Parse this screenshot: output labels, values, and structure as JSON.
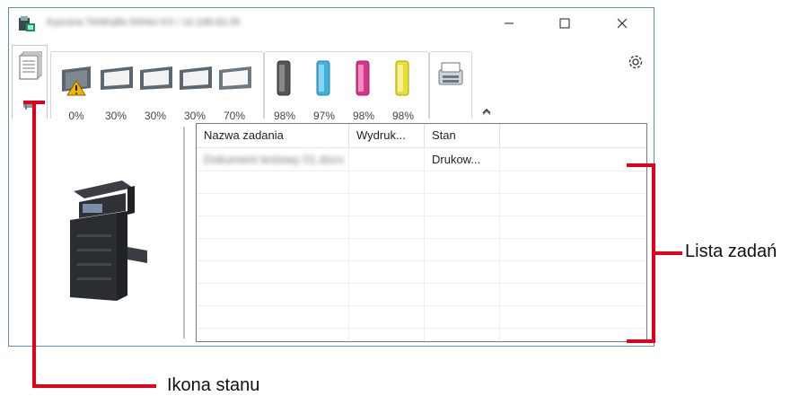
{
  "window": {
    "title": "Kyocera TASKalfa 5054ci KX / 10.168.63.35"
  },
  "titlebar_buttons": {
    "minimize_icon": "minimize-icon",
    "maximize_icon": "maximize-icon",
    "close_icon": "close-icon"
  },
  "toolbar": {
    "paper_trays": [
      {
        "level": "0%",
        "warning": true
      },
      {
        "level": "30%",
        "warning": false
      },
      {
        "level": "30%",
        "warning": false
      },
      {
        "level": "30%",
        "warning": false
      },
      {
        "level": "70%",
        "warning": false
      }
    ],
    "toners": [
      {
        "level": "98%",
        "color": "#444444"
      },
      {
        "level": "97%",
        "color": "#3fb3e0"
      },
      {
        "level": "98%",
        "color": "#d9338a"
      },
      {
        "level": "98%",
        "color": "#e8df2e"
      }
    ],
    "settings_icon": "gear-icon",
    "collapse_icon": "chevron-up-icon"
  },
  "job_list": {
    "columns": [
      "Nazwa zadania",
      "Wydruk...",
      "Stan"
    ],
    "rows": [
      {
        "name": "Dokument testowy 01.docx",
        "printed": "",
        "status": "Drukow..."
      }
    ]
  },
  "annotations": {
    "job_list_label": "Lista zadań",
    "status_icon_label": "Ikona stanu",
    "color": "#e3001b"
  }
}
